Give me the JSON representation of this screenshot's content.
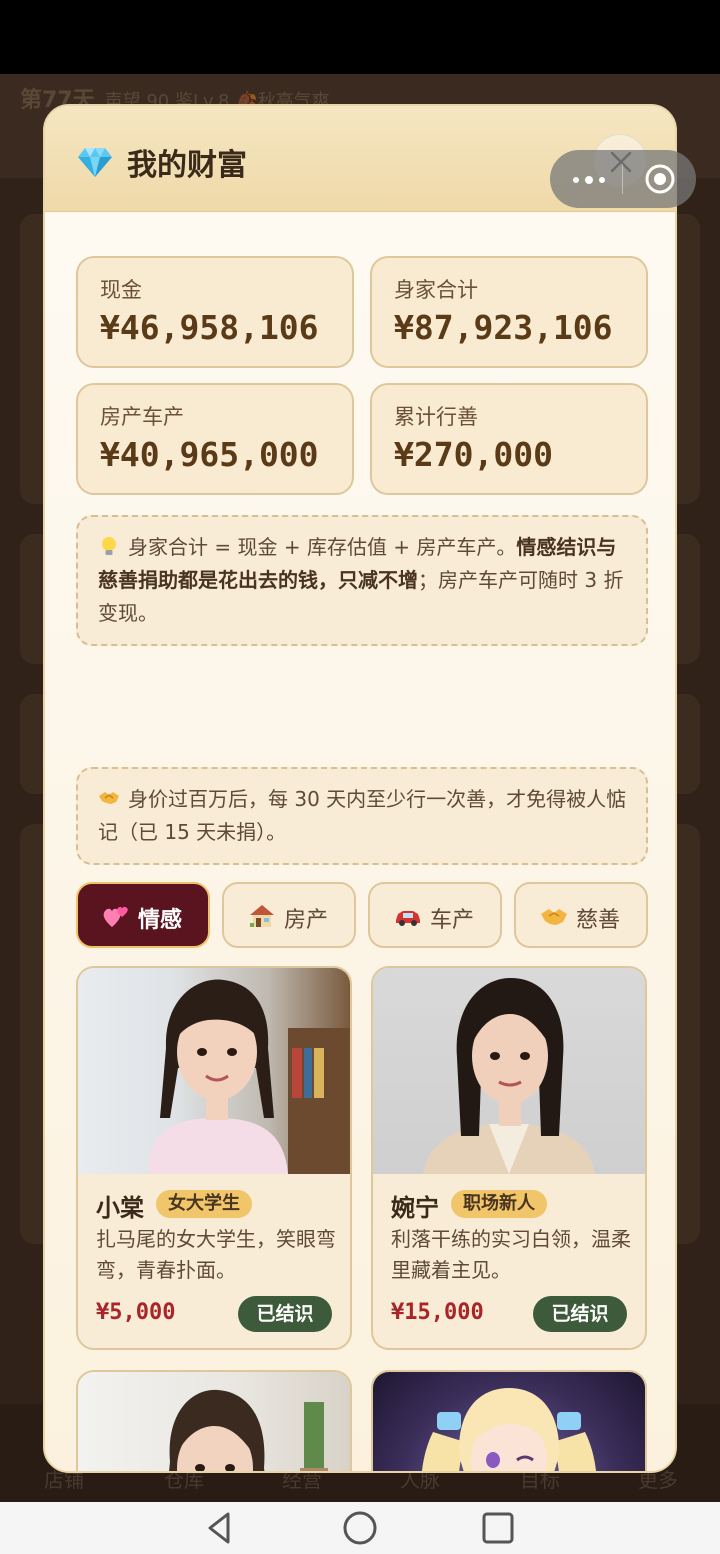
{
  "background": {
    "day": "第77天",
    "status": "声望 90 鉴Lv.8 🍂秋高气爽",
    "nav": [
      "店铺",
      "仓库",
      "经营",
      "人脉",
      "目标",
      "更多"
    ]
  },
  "modal": {
    "title": "我的财富",
    "close_icon": "close-icon",
    "stats": [
      {
        "label": "现金",
        "value": "¥46,958,106"
      },
      {
        "label": "身家合计",
        "value": "¥87,923,106"
      },
      {
        "label": "房产车产",
        "value": "¥40,965,000"
      },
      {
        "label": "累计行善",
        "value": "¥270,000"
      }
    ],
    "notice1": {
      "part1": "身家合计 = 现金 + 库存估值 + 房产车产。",
      "bold": "情感结识与慈善捐助都是花出去的钱，只减不增",
      "part2": "；房产车产可随时 3 折变现。"
    },
    "notice2": "身价过百万后，每 30 天内至少行一次善，才免得被人惦记（已 15 天未捐）。",
    "tabs": [
      {
        "label": "情感",
        "icon": "hearts-icon",
        "active": true
      },
      {
        "label": "房产",
        "icon": "house-icon",
        "active": false
      },
      {
        "label": "车产",
        "icon": "car-icon",
        "active": false
      },
      {
        "label": "慈善",
        "icon": "handshake-icon",
        "active": false
      }
    ],
    "people": [
      {
        "name": "小棠",
        "tag": "女大学生",
        "desc": "扎马尾的女大学生，笑眼弯弯，青春扑面。",
        "price": "¥5,000",
        "status": "已结识"
      },
      {
        "name": "婉宁",
        "tag": "职场新人",
        "desc": "利落干练的实习白领，温柔里藏着主见。",
        "price": "¥15,000",
        "status": "已结识"
      }
    ]
  },
  "colors": {
    "accent": "#5a1420",
    "price": "#a8252a",
    "badge": "#3d5a3a",
    "tag": "#f1c66a"
  }
}
